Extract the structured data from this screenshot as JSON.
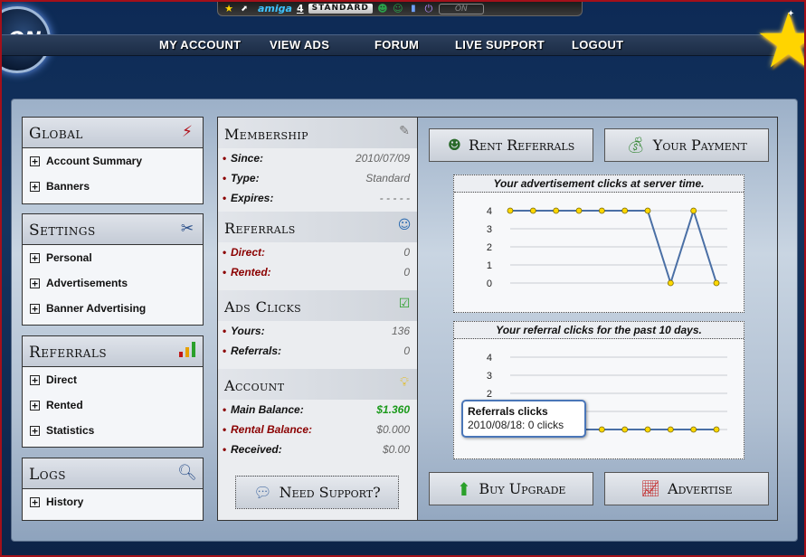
{
  "topbar": {
    "username": "amiga",
    "count": "4",
    "plan": "STANDARD",
    "logo_text": "ON"
  },
  "brand": {
    "logo_text": "ON"
  },
  "nav": [
    "MY ACCOUNT",
    "VIEW ADS",
    "FORUM",
    "LIVE SUPPORT",
    "LOGOUT"
  ],
  "sidebar": {
    "global": {
      "title": "Global",
      "items": [
        "Account Summary",
        "Banners"
      ]
    },
    "settings": {
      "title": "Settings",
      "items": [
        "Personal",
        "Advertisements",
        "Banner Advertising"
      ]
    },
    "referrals": {
      "title": "Referrals",
      "items": [
        "Direct",
        "Rented",
        "Statistics"
      ]
    },
    "logs": {
      "title": "Logs",
      "items": [
        "History"
      ]
    }
  },
  "membership": {
    "title": "Membership",
    "rows": [
      {
        "label": "Since:",
        "value": "2010/07/09"
      },
      {
        "label": "Type:",
        "value": "Standard"
      },
      {
        "label": "Expires:",
        "value": "- - - - -"
      }
    ]
  },
  "referrals_info": {
    "title": "Referrals",
    "rows": [
      {
        "label": "Direct:",
        "value": "0"
      },
      {
        "label": "Rented:",
        "value": "0"
      }
    ]
  },
  "ads_clicks": {
    "title": "Ads Clicks",
    "rows": [
      {
        "label": "Yours:",
        "value": "136"
      },
      {
        "label": "Referrals:",
        "value": "0"
      }
    ]
  },
  "account": {
    "title": "Account",
    "rows": [
      {
        "label": "Main Balance:",
        "value": "$1.360"
      },
      {
        "label": "Rental Balance:",
        "value": "$0.000"
      },
      {
        "label": "Received:",
        "value": "$0.00"
      }
    ]
  },
  "buttons": {
    "rent_referrals": "Rent Referrals",
    "your_payment": "Your Payment",
    "buy_upgrade": "Buy Upgrade",
    "advertise": "Advertise",
    "need_support": "Need Support?"
  },
  "colors": {
    "accent_green": "#1a9a1a",
    "label_red": "#8b0000",
    "line": "#4a6fa5",
    "point": "#ffd800"
  },
  "chart_data": [
    {
      "type": "line",
      "title": "Your advertisement clicks at server time.",
      "y_ticks": [
        0,
        1,
        2,
        3,
        4
      ],
      "ylim": [
        0,
        4
      ],
      "values": [
        4,
        4,
        4,
        4,
        4,
        4,
        4,
        0,
        4,
        0
      ],
      "grid": true
    },
    {
      "type": "line",
      "title": "Your referral clicks for the past 10 days.",
      "y_ticks": [
        0,
        1,
        2,
        3,
        4
      ],
      "ylim": [
        0,
        4
      ],
      "values": [
        0,
        0,
        0,
        0,
        0,
        0,
        0,
        0,
        0,
        0
      ],
      "grid": true,
      "tooltip": {
        "series": "Referrals clicks",
        "text": "2010/08/18: 0 clicks"
      }
    }
  ]
}
